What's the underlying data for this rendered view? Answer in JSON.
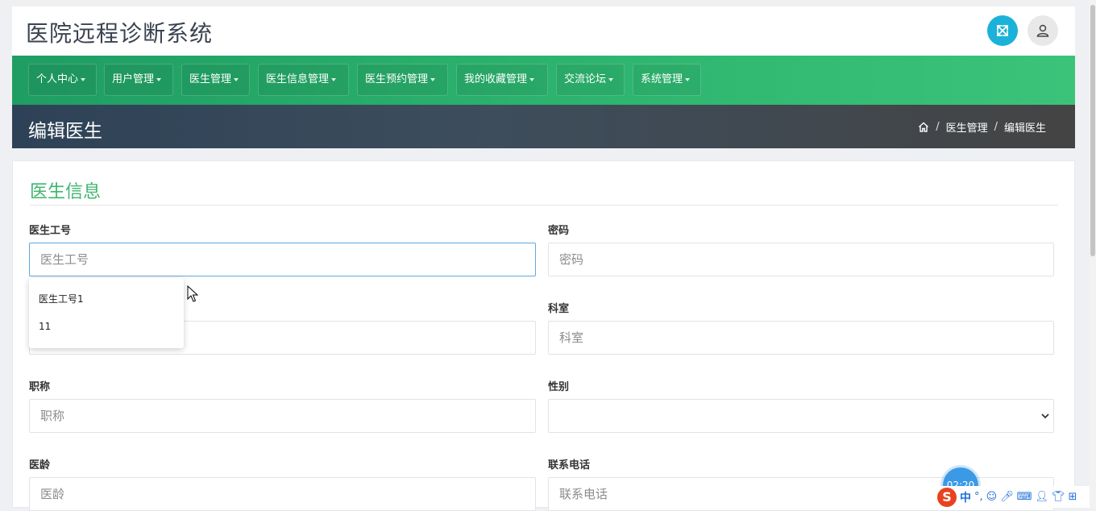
{
  "header": {
    "title": "医院远程诊断系统"
  },
  "nav": {
    "items": [
      {
        "label": "个人中心"
      },
      {
        "label": "用户管理"
      },
      {
        "label": "医生管理"
      },
      {
        "label": "医生信息管理"
      },
      {
        "label": "医生预约管理"
      },
      {
        "label": "我的收藏管理"
      },
      {
        "label": "交流论坛"
      },
      {
        "label": "系统管理"
      }
    ]
  },
  "page": {
    "title": "编辑医生"
  },
  "breadcrumb": {
    "items": [
      "医生管理",
      "编辑医生"
    ],
    "separator": "/"
  },
  "form": {
    "section_title": "医生信息",
    "fields": {
      "doctor_id": {
        "label": "医生工号",
        "placeholder": "医生工号",
        "value": ""
      },
      "password": {
        "label": "密码",
        "placeholder": "密码",
        "value": ""
      },
      "department": {
        "label": "科室",
        "placeholder": "科室",
        "value": ""
      },
      "title": {
        "label": "职称",
        "placeholder": "职称",
        "value": ""
      },
      "gender": {
        "label": "性别",
        "value": ""
      },
      "experience": {
        "label": "医龄",
        "placeholder": "医龄",
        "value": ""
      },
      "phone": {
        "label": "联系电话",
        "placeholder": "联系电话",
        "value": ""
      }
    },
    "autocomplete": [
      "医生工号1",
      "11"
    ]
  },
  "overlay": {
    "timer": "02:20",
    "ime_mode": "中",
    "ime_punct": "°,"
  },
  "colors": {
    "accent": "#3fb56f",
    "nav": "#2db56f",
    "expand": "#1ab2d8",
    "focus": "#5fa8dc"
  }
}
